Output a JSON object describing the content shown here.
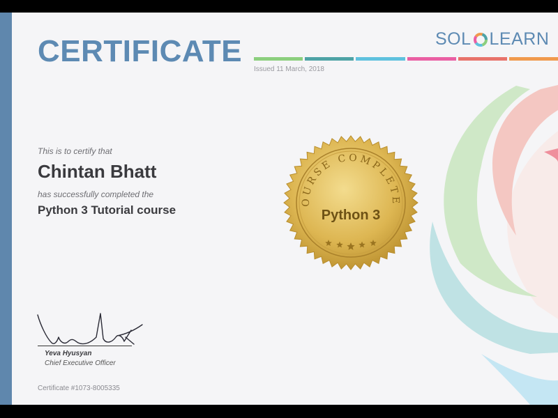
{
  "certificate": {
    "title": "CERTIFICATE",
    "issued": "Issued 11 March, 2018",
    "intro": "This is to certify that",
    "recipient": "Chintan Bhatt",
    "completed_text": "has successfully completed the",
    "course": "Python 3 Tutorial course",
    "certificate_number": "Certificate #1073-8005335"
  },
  "brand": {
    "left": "SOL",
    "right": "LEARN",
    "color": "#5d8ab3"
  },
  "seal": {
    "arc_text": "COURSE COMPLETED",
    "center_text": "Python 3",
    "star_count": 5,
    "color": "#d9b24a"
  },
  "signature": {
    "name": "Yeva Hyusyan",
    "title": "Chief Executive Officer"
  },
  "colors": {
    "accent": "#5f87ad",
    "rule_segments": [
      "#8ccf7e",
      "#4ea3a6",
      "#5fc1de",
      "#ea5fa3",
      "#e8736b",
      "#f09a4d"
    ]
  }
}
